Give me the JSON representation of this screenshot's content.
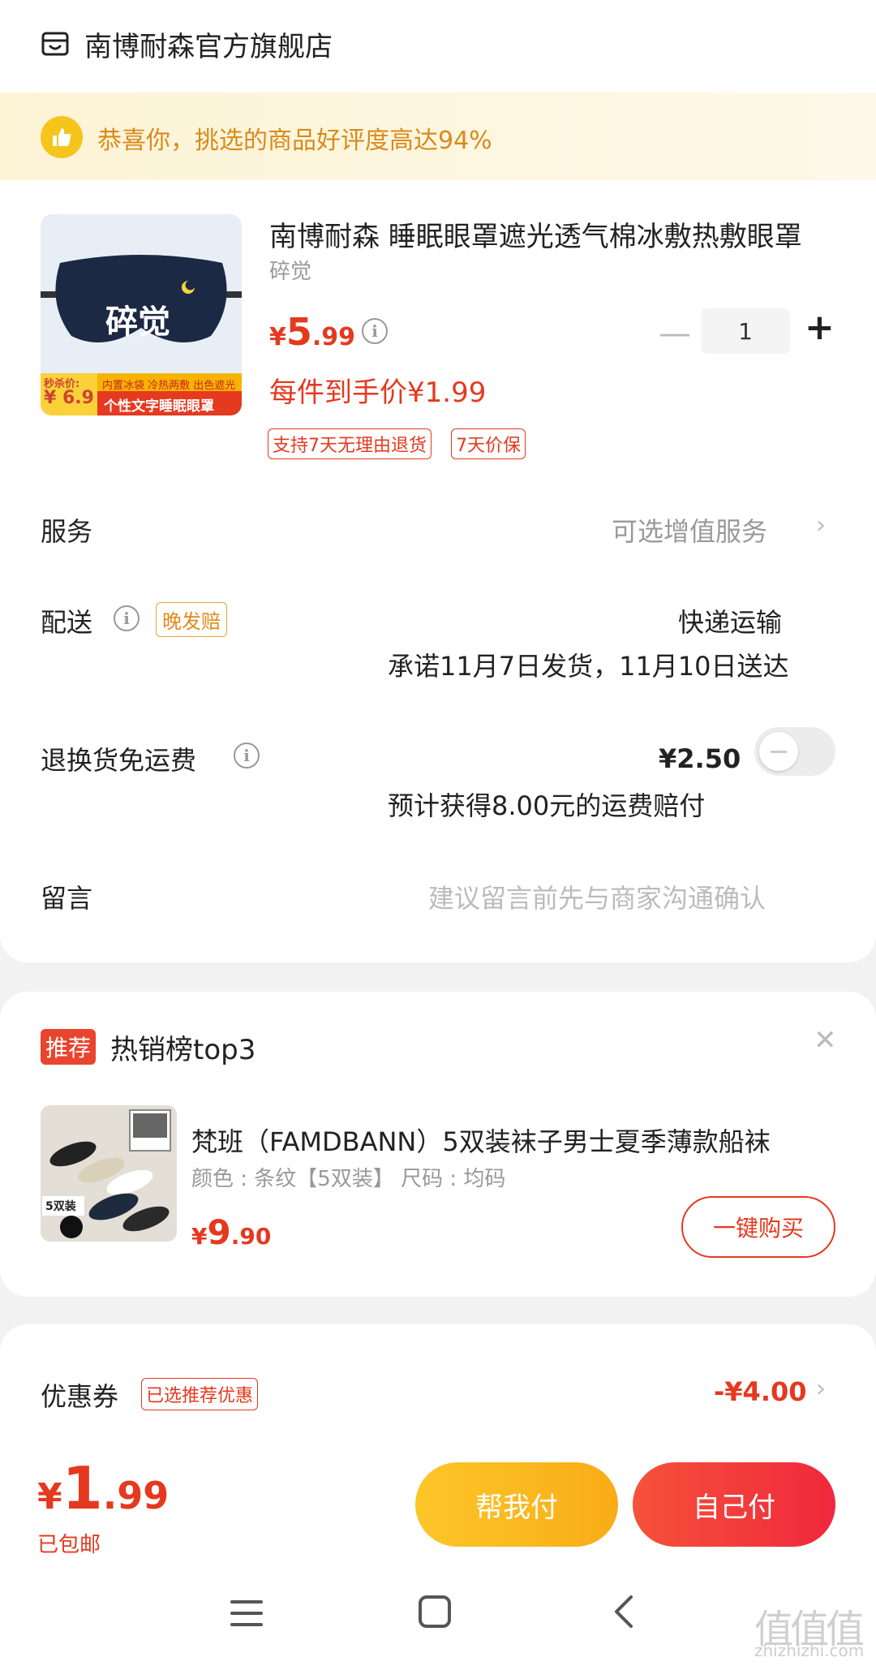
{
  "store": {
    "name": "南博耐森官方旗舰店"
  },
  "banner": {
    "text": "恭喜你，挑选的商品好评度高达94%"
  },
  "product": {
    "title": "南博耐森  睡眠眼罩遮光透气棉冰敷热敷眼罩",
    "spec": "碎觉",
    "image_text": "碎觉",
    "image_badge_label": "秒杀价:",
    "image_badge_price": "¥ 6.9",
    "image_caption_top": "内置冰袋  冷热两敷  出色遮光",
    "image_caption": "个性文字睡眠眼罩",
    "price_currency": "¥",
    "price_int": "5",
    "price_dec": ".99",
    "quantity": "1",
    "minus_label": "—",
    "plus_label": "+",
    "final_price": "每件到手价¥1.99",
    "tags": [
      "支持7天无理由退货",
      "7天价保"
    ]
  },
  "service": {
    "label": "服务",
    "value": "可选增值服务"
  },
  "delivery": {
    "label": "配送",
    "tag": "晚发赔",
    "method": "快递运输",
    "promise": "承诺11月7日发货，11月10日送达"
  },
  "return_shipping": {
    "label": "退换货免运费",
    "price": "¥2.50",
    "note": "预计获得8.00元的运费赔付",
    "enabled": false
  },
  "message": {
    "label": "留言",
    "placeholder": "建议留言前先与商家沟通确认"
  },
  "recommend": {
    "badge": "推荐",
    "title": "热销榜top3",
    "item": {
      "name": "梵班（FAMDBANN）5双装袜子男士夏季薄款船袜",
      "spec": "颜色 : 条纹【5双装】    尺码 : 均码",
      "image_label": "5双装",
      "price_currency": "¥",
      "price_int": "9",
      "price_dec": ".90",
      "buy_label": "一键购买"
    }
  },
  "coupon": {
    "label": "优惠券",
    "tag": "已选推荐优惠",
    "value": "-¥4.00"
  },
  "checkout": {
    "currency": "¥",
    "total_int": "1",
    "total_dec": ".99",
    "shipping": "已包邮",
    "help_pay": "帮我付",
    "self_pay": "自己付"
  },
  "watermark": {
    "text": "值值值",
    "sub": "zhizhizhi.com"
  },
  "colors": {
    "accent": "#e5391f",
    "yellow_btn": "#fbb91f",
    "red_btn": "#f2363b",
    "banner_bg": "#fdf4d6"
  }
}
